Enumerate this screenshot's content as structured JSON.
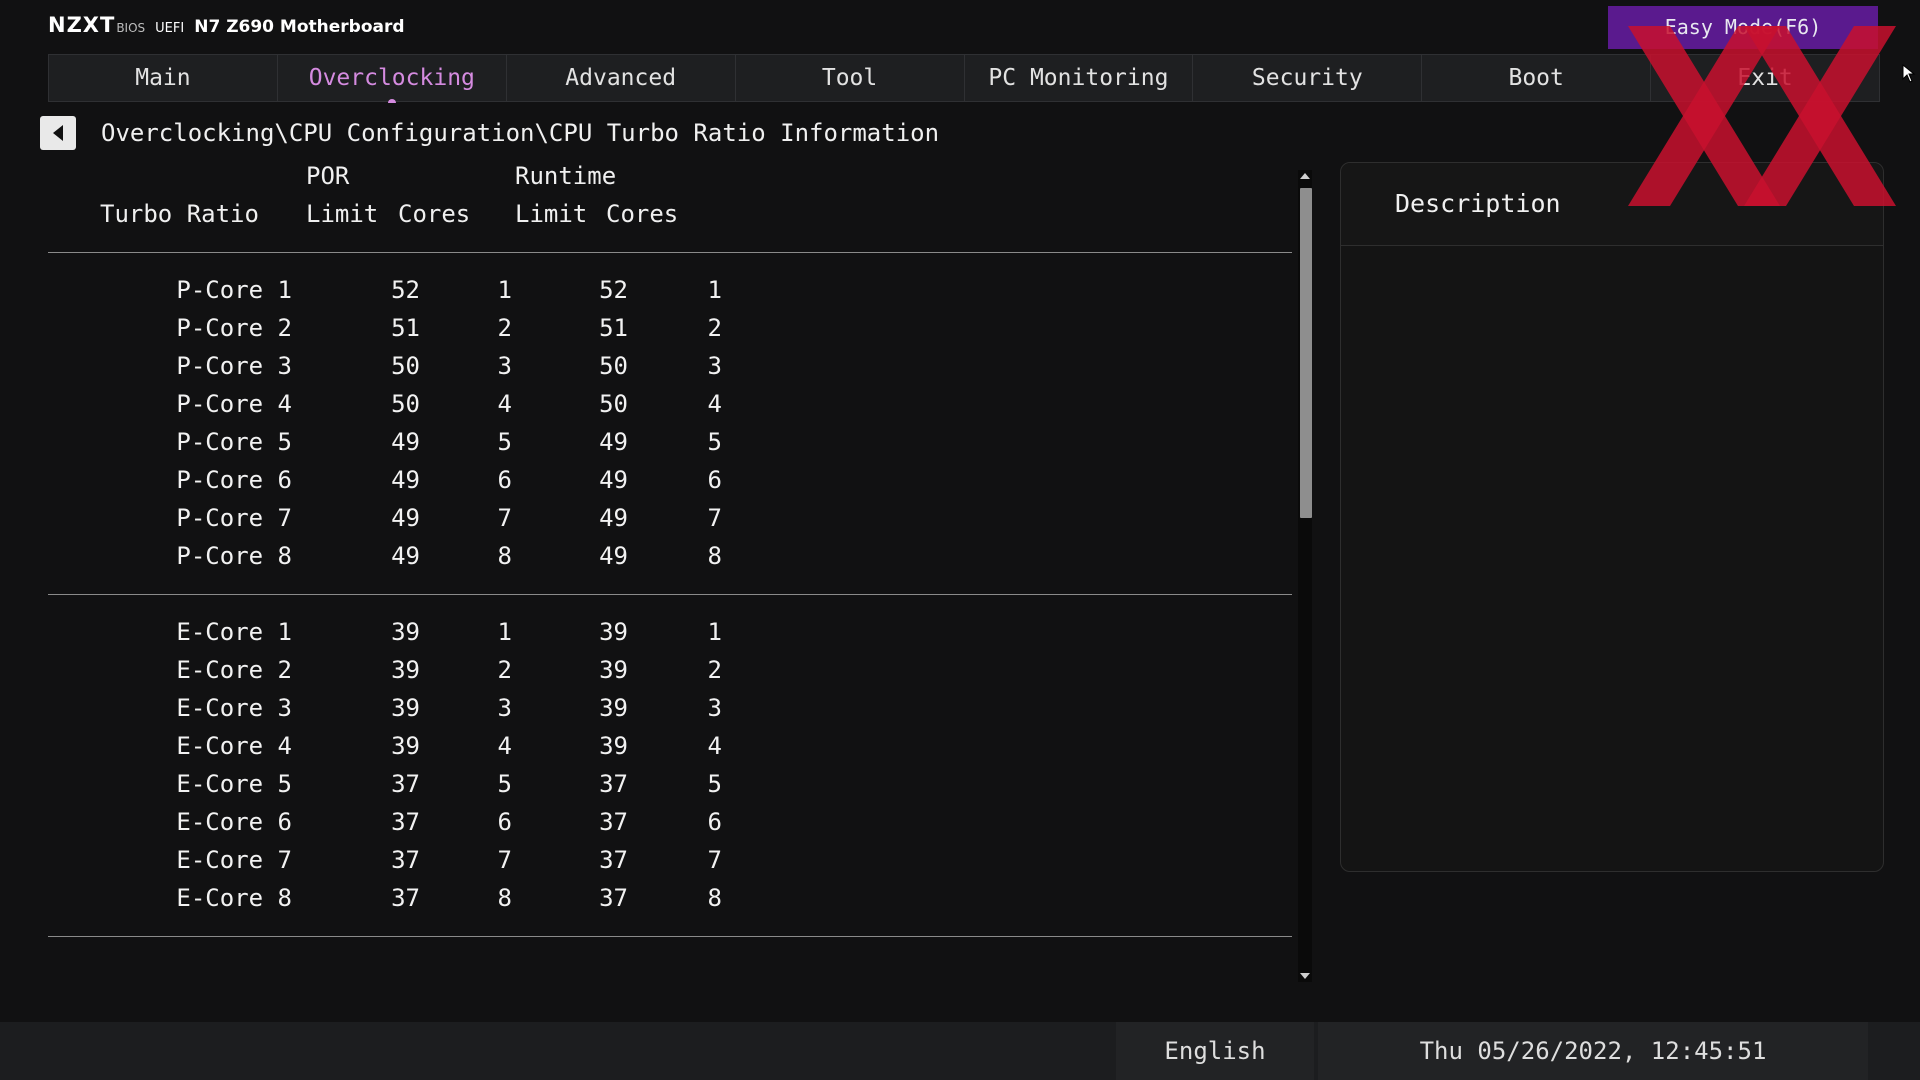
{
  "brand": {
    "logo": "NZXT",
    "bios": "BIOS",
    "uefi": "UEFI",
    "board": "N7 Z690 Motherboard"
  },
  "easy_mode_label": "Easy Mode(F6)",
  "menu": [
    {
      "label": "Main",
      "active": false
    },
    {
      "label": "Overclocking",
      "active": true
    },
    {
      "label": "Advanced",
      "active": false
    },
    {
      "label": "Tool",
      "active": false
    },
    {
      "label": "PC Monitoring",
      "active": false
    },
    {
      "label": "Security",
      "active": false
    },
    {
      "label": "Boot",
      "active": false
    },
    {
      "label": "Exit",
      "active": false
    }
  ],
  "breadcrumb": "Overclocking\\CPU Configuration\\CPU Turbo Ratio Information",
  "table": {
    "header": {
      "por": "POR",
      "runtime": "Runtime",
      "turbo_ratio": "Turbo Ratio",
      "por_limit": "Limit",
      "por_cores": "Cores",
      "rt_limit": "Limit",
      "rt_cores": "Cores"
    },
    "pcores": [
      {
        "name": "P-Core 1",
        "por_limit": "52",
        "por_cores": "1",
        "rt_limit": "52",
        "rt_cores": "1"
      },
      {
        "name": "P-Core 2",
        "por_limit": "51",
        "por_cores": "2",
        "rt_limit": "51",
        "rt_cores": "2"
      },
      {
        "name": "P-Core 3",
        "por_limit": "50",
        "por_cores": "3",
        "rt_limit": "50",
        "rt_cores": "3"
      },
      {
        "name": "P-Core 4",
        "por_limit": "50",
        "por_cores": "4",
        "rt_limit": "50",
        "rt_cores": "4"
      },
      {
        "name": "P-Core 5",
        "por_limit": "49",
        "por_cores": "5",
        "rt_limit": "49",
        "rt_cores": "5"
      },
      {
        "name": "P-Core 6",
        "por_limit": "49",
        "por_cores": "6",
        "rt_limit": "49",
        "rt_cores": "6"
      },
      {
        "name": "P-Core 7",
        "por_limit": "49",
        "por_cores": "7",
        "rt_limit": "49",
        "rt_cores": "7"
      },
      {
        "name": "P-Core 8",
        "por_limit": "49",
        "por_cores": "8",
        "rt_limit": "49",
        "rt_cores": "8"
      }
    ],
    "ecores": [
      {
        "name": "E-Core 1",
        "por_limit": "39",
        "por_cores": "1",
        "rt_limit": "39",
        "rt_cores": "1"
      },
      {
        "name": "E-Core 2",
        "por_limit": "39",
        "por_cores": "2",
        "rt_limit": "39",
        "rt_cores": "2"
      },
      {
        "name": "E-Core 3",
        "por_limit": "39",
        "por_cores": "3",
        "rt_limit": "39",
        "rt_cores": "3"
      },
      {
        "name": "E-Core 4",
        "por_limit": "39",
        "por_cores": "4",
        "rt_limit": "39",
        "rt_cores": "4"
      },
      {
        "name": "E-Core 5",
        "por_limit": "37",
        "por_cores": "5",
        "rt_limit": "37",
        "rt_cores": "5"
      },
      {
        "name": "E-Core 6",
        "por_limit": "37",
        "por_cores": "6",
        "rt_limit": "37",
        "rt_cores": "6"
      },
      {
        "name": "E-Core 7",
        "por_limit": "37",
        "por_cores": "7",
        "rt_limit": "37",
        "rt_cores": "7"
      },
      {
        "name": "E-Core 8",
        "por_limit": "37",
        "por_cores": "8",
        "rt_limit": "37",
        "rt_cores": "8"
      }
    ]
  },
  "description_title": "Description",
  "footer": {
    "language": "English",
    "datetime": "Thu 05/26/2022, 12:45:51"
  },
  "colors": {
    "accent": "#d58be0",
    "easy_mode_bg": "#5a1a8e",
    "watermark": "#c8102e"
  },
  "icons": {
    "back": "back-arrow-icon",
    "cursor": "mouse-cursor-icon",
    "watermark": "xx-watermark-logo"
  }
}
